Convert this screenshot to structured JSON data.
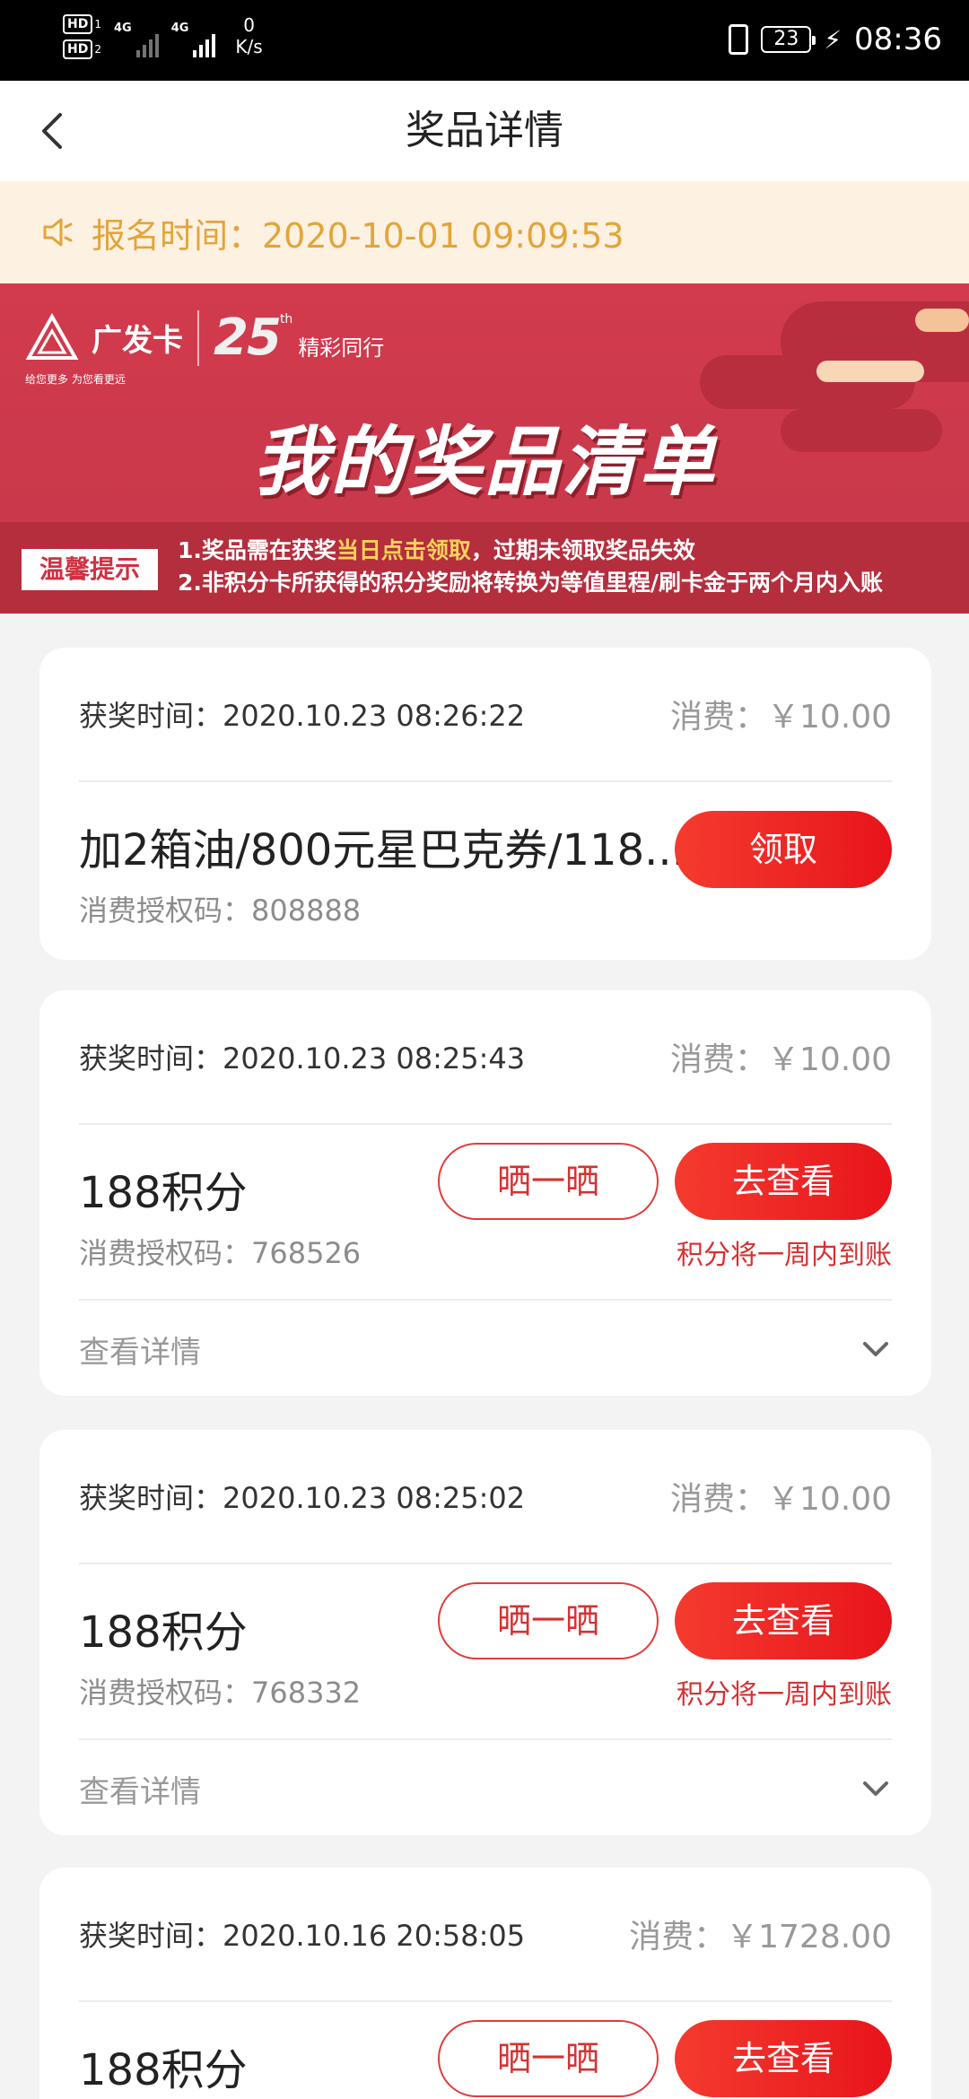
{
  "status_bar": {
    "hd1": "HD",
    "hd1_sub": "1",
    "hd2": "HD",
    "hd2_sub": "2",
    "net1": "4G",
    "net2": "4G",
    "speed_value": "0",
    "speed_unit": "K/s",
    "battery": "23",
    "time": "08:36"
  },
  "nav": {
    "title": "奖品详情"
  },
  "notice": {
    "text": "报名时间：2020-10-01 09:09:53"
  },
  "banner": {
    "brand_name": "广发卡",
    "brand_sub": "给您更多  为您看更远",
    "anniv_number": "25",
    "anniv_suffix": "th",
    "anniv_slogan": "精彩同行",
    "title": "我的奖品清单",
    "tips_tag": "温馨提示",
    "tip1_prefix": "1.奖品需在获奖",
    "tip1_highlight": "当日点击领取",
    "tip1_suffix": "，过期未领取奖品失效",
    "tip2": "2.非积分卡所获得的积分奖励将转换为等值里程/刷卡金于两个月内入账"
  },
  "cards": [
    {
      "win_time": "获奖时间：2020.10.23 08:26:22",
      "cost": "消费：￥10.00",
      "prize": "加2箱油/800元星巴克券/118...",
      "code": "消费授权码：808888",
      "primary_button": "领取"
    },
    {
      "win_time": "获奖时间：2020.10.23 08:25:43",
      "cost": "消费：￥10.00",
      "prize": "188积分",
      "code": "消费授权码：768526",
      "share_button": "晒一晒",
      "primary_button": "去查看",
      "note": "积分将一周内到账",
      "detail_label": "查看详情"
    },
    {
      "win_time": "获奖时间：2020.10.23 08:25:02",
      "cost": "消费：￥10.00",
      "prize": "188积分",
      "code": "消费授权码：768332",
      "share_button": "晒一晒",
      "primary_button": "去查看",
      "note": "积分将一周内到账",
      "detail_label": "查看详情"
    },
    {
      "win_time": "获奖时间：2020.10.16 20:58:05",
      "cost": "消费：￥1728.00",
      "prize": "188积分",
      "share_button": "晒一晒",
      "primary_button": "去查看"
    }
  ],
  "icons": {
    "back": "back-arrow-icon",
    "speaker": "speaker-icon",
    "chevron": "chevron-down-icon",
    "logo": "triangle-logo-icon"
  },
  "colors": {
    "accent_red": "#e8141b",
    "notice_text": "#e2a53a",
    "notice_bg": "#fdf1e2",
    "banner_red": "#d23a4d"
  }
}
